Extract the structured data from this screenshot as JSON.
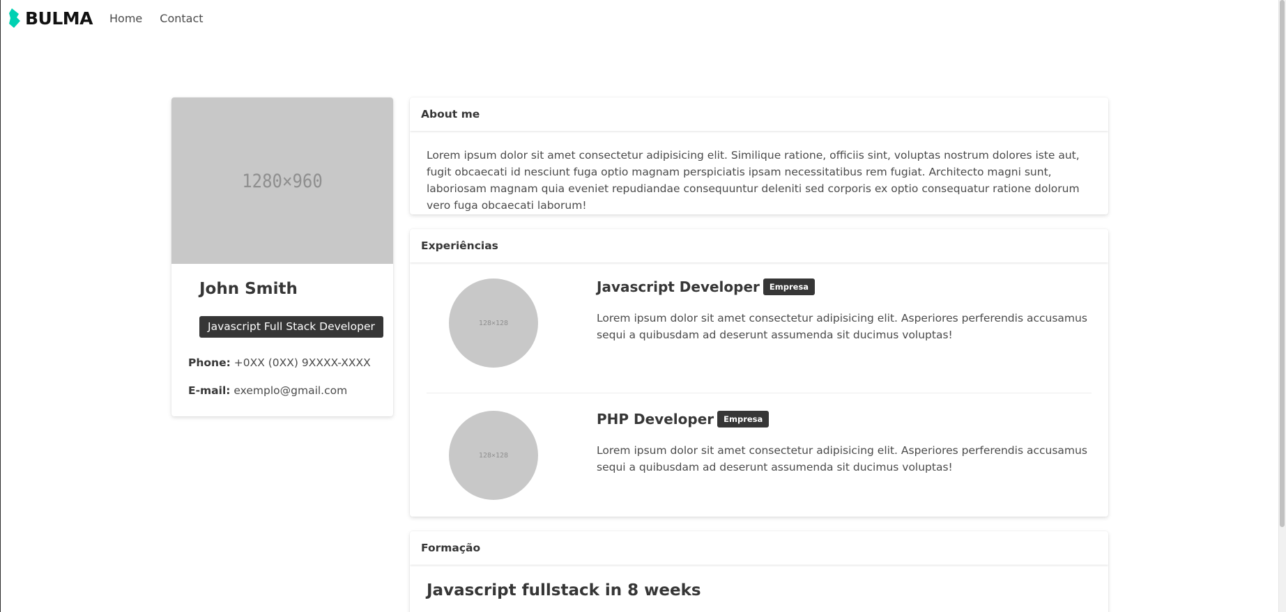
{
  "navbar": {
    "brand": "BULMA",
    "items": [
      "Home",
      "Contact"
    ]
  },
  "profile": {
    "image_placeholder": "1280×960",
    "name": "John Smith",
    "role": "Javascript Full Stack Developer",
    "phone_label": "Phone:",
    "phone_value": "+0XX (0XX) 9XXXX-XXXX",
    "email_label": "E-mail:",
    "email_value": "exemplo@gmail.com"
  },
  "about": {
    "title": "About me",
    "text": "Lorem ipsum dolor sit amet consectetur adipisicing elit. Similique ratione, officiis sint, voluptas nostrum dolores iste aut, fugit obcaecati id nesciunt fuga optio magnam perspiciatis ipsam necessitatibus rem fugiat. Architecto magni sunt, laboriosam magnam quia eveniet repudiandae consequuntur deleniti sed corporis ex optio consequatur ratione dolorum vero fuga obcaecati laborum!"
  },
  "experiences": {
    "title": "Experiências",
    "items": [
      {
        "avatar": "128×128",
        "title": "Javascript Developer",
        "tag": "Empresa",
        "description": "Lorem ipsum dolor sit amet consectetur adipisicing elit. Asperiores perferendis accusamus sequi a quibusdam ad deserunt assumenda sit ducimus voluptas!"
      },
      {
        "avatar": "128×128",
        "title": "PHP Developer",
        "tag": "Empresa",
        "description": "Lorem ipsum dolor sit amet consectetur adipisicing elit. Asperiores perferendis accusamus sequi a quibusdam ad deserunt assumenda sit ducimus voluptas!"
      }
    ]
  },
  "formacao": {
    "title": "Formação",
    "course": "Javascript fullstack in 8 weeks"
  },
  "colors": {
    "brand_accent": "#00d1b2",
    "tag_bg": "#363636",
    "placeholder_bg": "#c8c8c8"
  }
}
